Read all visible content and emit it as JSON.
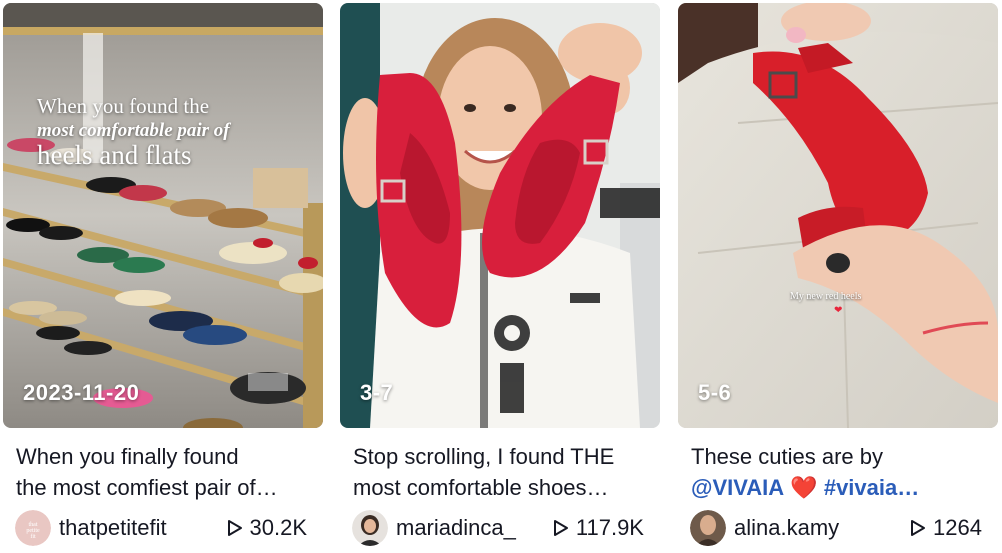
{
  "cards": [
    {
      "date_badge": "2023-11-20",
      "overlay": {
        "line1": "When you found the",
        "line2": "most comfortable pair of",
        "line3": "heels and flats"
      },
      "description_line1": "When you finally found",
      "description_line2": "the most comfiest pair of…",
      "avatar_text": "thatpetitefit",
      "username": "thatpetitefit",
      "views": "30.2K",
      "icon": "play-icon"
    },
    {
      "date_badge": "3-7",
      "description_line1": "Stop scrolling, I found THE",
      "description_line2": "most comfortable shoes…",
      "username": "mariadinca_",
      "views": "117.9K",
      "icon": "play-icon"
    },
    {
      "date_badge": "5-6",
      "overlay_caption": "My new red heels",
      "overlay_heart": "❤",
      "description_line1": "These cuties are by",
      "description_line2_mention": "@VIVAIA",
      "description_line2_heart": "❤️",
      "description_line2_hashtag": "#vivaia…",
      "username": "alina.kamy",
      "views": "1264",
      "icon": "play-icon"
    }
  ],
  "colors": {
    "text": "#161823",
    "hashtag": "#2b5db9",
    "heart": "#e3232f",
    "shoe_red": "#d81f3c"
  }
}
